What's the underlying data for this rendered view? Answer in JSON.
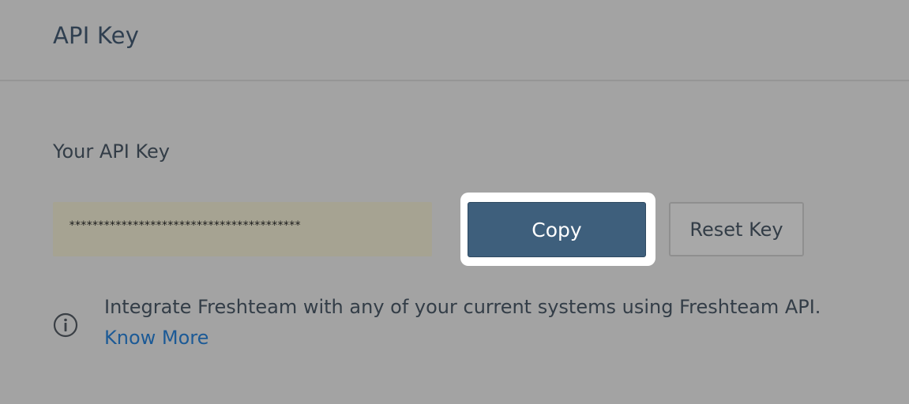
{
  "header": {
    "title": "API Key"
  },
  "api_key": {
    "label": "Your API Key",
    "masked_value": "****************************************"
  },
  "buttons": {
    "copy_label": "Copy",
    "reset_label": "Reset Key"
  },
  "info": {
    "icon": "info-icon",
    "text": "Integrate Freshteam with any of your current systems using Freshteam API.",
    "link_label": "Know More"
  },
  "colors": {
    "overlay_background": "#a3a3a3",
    "copy_button": "#3e5f7c",
    "link": "#1c5a96",
    "key_field": "#a6a392"
  }
}
